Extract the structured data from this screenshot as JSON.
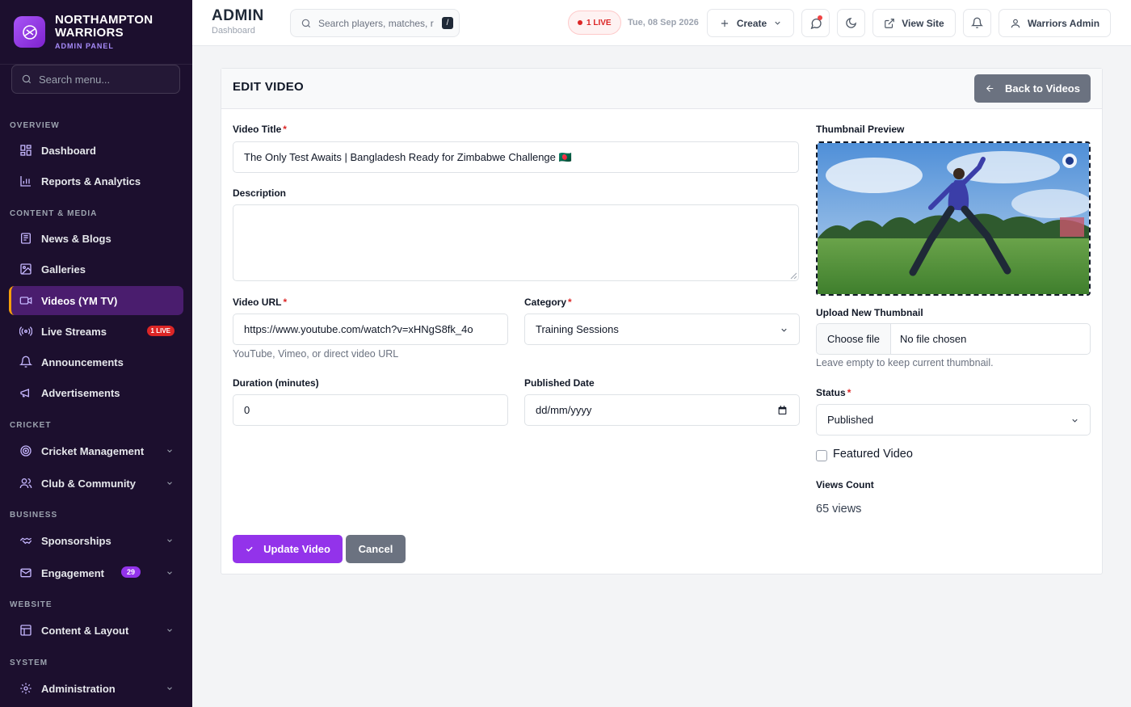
{
  "sidebar": {
    "brand_line1": "NORTHAMPTON",
    "brand_line2": "WARRIORS",
    "brand_sub": "ADMIN PANEL",
    "search_placeholder": "Search menu...",
    "sections": {
      "overview": "OVERVIEW",
      "content_media": "CONTENT & MEDIA",
      "cricket": "CRICKET",
      "business": "BUSINESS",
      "website": "WEBSITE",
      "system": "SYSTEM"
    },
    "items": {
      "dashboard": "Dashboard",
      "reports": "Reports & Analytics",
      "news": "News & Blogs",
      "galleries": "Galleries",
      "videos": "Videos (YM TV)",
      "live_streams": "Live Streams",
      "live_badge": "1 LIVE",
      "announcements": "Announcements",
      "advertisements": "Advertisements",
      "cricket_mgmt": "Cricket Management",
      "club": "Club & Community",
      "sponsorships": "Sponsorships",
      "engagement": "Engagement",
      "engagement_count": "29",
      "content_layout": "Content & Layout",
      "administration": "Administration"
    }
  },
  "topbar": {
    "title": "ADMIN",
    "subtitle": "Dashboard",
    "search_placeholder": "Search players, matches, r",
    "search_shortcut": "/",
    "live_pill": "1 LIVE",
    "date": "Tue, 08 Sep 2026",
    "create_label": "Create",
    "view_site_label": "View Site",
    "user_label": "Warriors Admin"
  },
  "form": {
    "heading": "EDIT VIDEO",
    "back_label": "Back to Videos",
    "title_label": "Video Title",
    "title_value": "The Only Test Awaits | Bangladesh Ready for Zimbabwe Challenge 🇧🇩",
    "description_label": "Description",
    "description_value": "",
    "url_label": "Video URL",
    "url_value": "https://www.youtube.com/watch?v=xHNgS8fk_4o",
    "url_help": "YouTube, Vimeo, or direct video URL",
    "category_label": "Category",
    "category_value": "Training Sessions",
    "duration_label": "Duration (minutes)",
    "duration_value": "0",
    "published_label": "Published Date",
    "published_placeholder": "dd/mm/yyyy",
    "thumb_label": "Thumbnail Preview",
    "upload_label": "Upload New Thumbnail",
    "choose_file": "Choose file",
    "no_file": "No file chosen",
    "upload_help": "Leave empty to keep current thumbnail.",
    "status_label": "Status",
    "status_value": "Published",
    "featured_label": "Featured Video",
    "featured_checked": false,
    "views_label": "Views Count",
    "views_value": "65 views",
    "update_label": "Update Video",
    "cancel_label": "Cancel",
    "required_mark": "*"
  },
  "colors": {
    "sidebar_bg": "#1c0f2e",
    "accent": "#9333ea",
    "active_border": "#f59e0b",
    "live": "#dc2626",
    "secondary_btn": "#6b7280"
  }
}
